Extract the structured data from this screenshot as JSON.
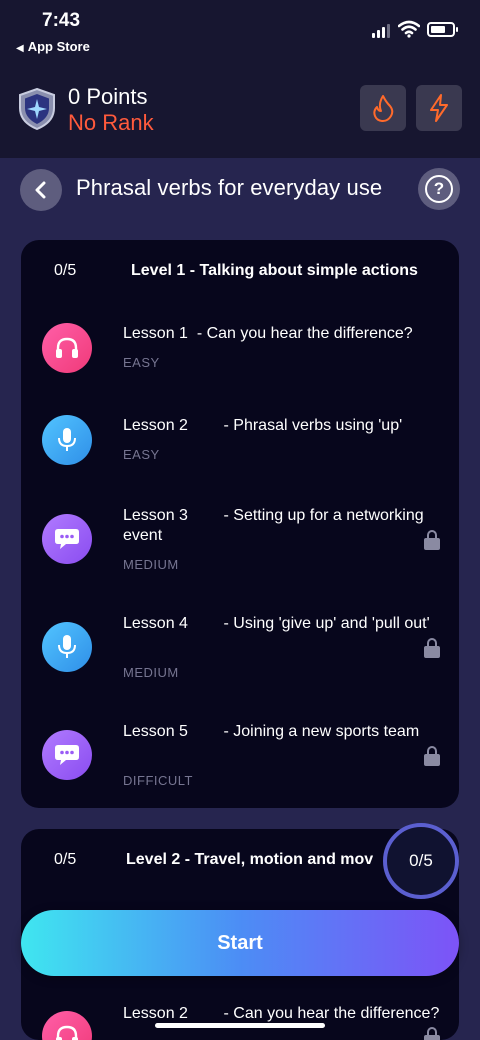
{
  "status": {
    "time": "7:43",
    "back_app": "App Store"
  },
  "header": {
    "points": "0 Points",
    "rank": "No Rank"
  },
  "page": {
    "title": "Phrasal verbs for everyday use"
  },
  "level1": {
    "count": "0/5",
    "title": "Level 1 - Talking about simple actions",
    "lessons": [
      {
        "title": "Lesson 1  - Can you hear the difference?",
        "difficulty": "EASY",
        "icon": "headphones-icon",
        "locked": false
      },
      {
        "title": "Lesson 2        - Phrasal verbs using 'up'",
        "difficulty": "EASY",
        "icon": "microphone-icon",
        "locked": false
      },
      {
        "title": "Lesson 3        - Setting up for a networking event",
        "difficulty": "MEDIUM",
        "icon": "chat-bubble-icon",
        "locked": true
      },
      {
        "title": "Lesson 4        - Using 'give up' and 'pull out'",
        "difficulty": "MEDIUM",
        "icon": "microphone-icon",
        "locked": true
      },
      {
        "title": "Lesson 5        - Joining a new sports team",
        "difficulty": "DIFFICULT",
        "icon": "chat-bubble-icon",
        "locked": true
      }
    ]
  },
  "level2": {
    "count": "0/5",
    "title": "Level 2 - Travel, motion and mov",
    "progress": "0/5",
    "lessons": [
      {
        "title": "Lesson 2        - Can you hear the difference?",
        "icon": "headphones-icon",
        "locked": true
      }
    ]
  },
  "start_button": {
    "label": "Start"
  },
  "colors": {
    "accent_rank": "#ff5a3c",
    "card_bg": "#07061c",
    "page_bg": "#26254f"
  }
}
